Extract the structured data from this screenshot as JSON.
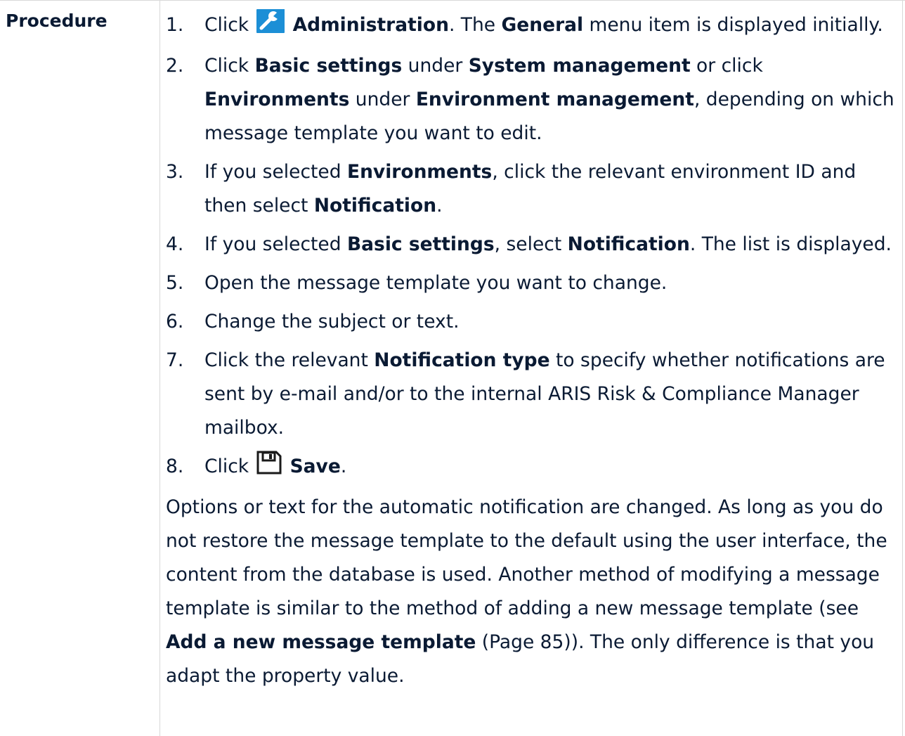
{
  "label": "Procedure",
  "steps": [
    {
      "num": "1.",
      "t1": "Click",
      "icon": "wrench-icon",
      "b1": "Administration",
      "t2": ". The ",
      "b2": "General",
      "t3": " menu item is displayed initially."
    },
    {
      "num": "2.",
      "t1": "Click ",
      "b1": "Basic settings",
      "t2": " under ",
      "b2": "System management",
      "t3": " or click ",
      "b3": "Environments",
      "t4": " under ",
      "b4": "Environment management",
      "t5": ", depending on which message template you want to edit."
    },
    {
      "num": "3.",
      "t1": "If you selected ",
      "b1": "Environments",
      "t2": ", click the relevant environment ID and then select ",
      "b2": "Notification",
      "t3": "."
    },
    {
      "num": "4.",
      "t1": "If you selected ",
      "b1": "Basic settings",
      "t2": ", select ",
      "b2": "Notification",
      "t3": ". The list is displayed."
    },
    {
      "num": "5.",
      "t1": "Open the message template you want to change."
    },
    {
      "num": "6.",
      "t1": "Change the subject or text."
    },
    {
      "num": "7.",
      "t1": "Click the relevant ",
      "b1": "Notification type",
      "t2": " to specify whether notifications are sent by e-mail and/or to the internal ARIS Risk & Compliance Manager mailbox."
    },
    {
      "num": "8.",
      "t1": "Click",
      "icon": "save-icon",
      "b1": "Save",
      "t2": "."
    }
  ],
  "result": {
    "t1": "Options or text for the automatic notification are changed. As long as you do not restore the message template to the default using the user interface, the content from the database is used. Another method of modifying a message template is similar to the method of adding a new message template (see ",
    "link": "Add a new message template",
    "t2": " (Page 85)). The only difference is that you adapt the property value."
  },
  "colors": {
    "text": "#0a1a33",
    "wrench_icon_bg": "#1c8fd6",
    "rule": "#d8d8d8"
  }
}
